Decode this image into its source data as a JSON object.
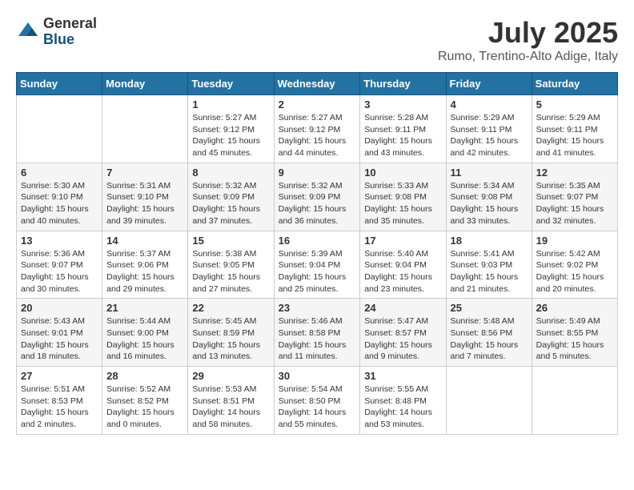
{
  "header": {
    "logo_general": "General",
    "logo_blue": "Blue",
    "month_title": "July 2025",
    "subtitle": "Rumo, Trentino-Alto Adige, Italy"
  },
  "days_of_week": [
    "Sunday",
    "Monday",
    "Tuesday",
    "Wednesday",
    "Thursday",
    "Friday",
    "Saturday"
  ],
  "weeks": [
    [
      {
        "day": "",
        "info": ""
      },
      {
        "day": "",
        "info": ""
      },
      {
        "day": "1",
        "info": "Sunrise: 5:27 AM\nSunset: 9:12 PM\nDaylight: 15 hours\nand 45 minutes."
      },
      {
        "day": "2",
        "info": "Sunrise: 5:27 AM\nSunset: 9:12 PM\nDaylight: 15 hours\nand 44 minutes."
      },
      {
        "day": "3",
        "info": "Sunrise: 5:28 AM\nSunset: 9:11 PM\nDaylight: 15 hours\nand 43 minutes."
      },
      {
        "day": "4",
        "info": "Sunrise: 5:29 AM\nSunset: 9:11 PM\nDaylight: 15 hours\nand 42 minutes."
      },
      {
        "day": "5",
        "info": "Sunrise: 5:29 AM\nSunset: 9:11 PM\nDaylight: 15 hours\nand 41 minutes."
      }
    ],
    [
      {
        "day": "6",
        "info": "Sunrise: 5:30 AM\nSunset: 9:10 PM\nDaylight: 15 hours\nand 40 minutes."
      },
      {
        "day": "7",
        "info": "Sunrise: 5:31 AM\nSunset: 9:10 PM\nDaylight: 15 hours\nand 39 minutes."
      },
      {
        "day": "8",
        "info": "Sunrise: 5:32 AM\nSunset: 9:09 PM\nDaylight: 15 hours\nand 37 minutes."
      },
      {
        "day": "9",
        "info": "Sunrise: 5:32 AM\nSunset: 9:09 PM\nDaylight: 15 hours\nand 36 minutes."
      },
      {
        "day": "10",
        "info": "Sunrise: 5:33 AM\nSunset: 9:08 PM\nDaylight: 15 hours\nand 35 minutes."
      },
      {
        "day": "11",
        "info": "Sunrise: 5:34 AM\nSunset: 9:08 PM\nDaylight: 15 hours\nand 33 minutes."
      },
      {
        "day": "12",
        "info": "Sunrise: 5:35 AM\nSunset: 9:07 PM\nDaylight: 15 hours\nand 32 minutes."
      }
    ],
    [
      {
        "day": "13",
        "info": "Sunrise: 5:36 AM\nSunset: 9:07 PM\nDaylight: 15 hours\nand 30 minutes."
      },
      {
        "day": "14",
        "info": "Sunrise: 5:37 AM\nSunset: 9:06 PM\nDaylight: 15 hours\nand 29 minutes."
      },
      {
        "day": "15",
        "info": "Sunrise: 5:38 AM\nSunset: 9:05 PM\nDaylight: 15 hours\nand 27 minutes."
      },
      {
        "day": "16",
        "info": "Sunrise: 5:39 AM\nSunset: 9:04 PM\nDaylight: 15 hours\nand 25 minutes."
      },
      {
        "day": "17",
        "info": "Sunrise: 5:40 AM\nSunset: 9:04 PM\nDaylight: 15 hours\nand 23 minutes."
      },
      {
        "day": "18",
        "info": "Sunrise: 5:41 AM\nSunset: 9:03 PM\nDaylight: 15 hours\nand 21 minutes."
      },
      {
        "day": "19",
        "info": "Sunrise: 5:42 AM\nSunset: 9:02 PM\nDaylight: 15 hours\nand 20 minutes."
      }
    ],
    [
      {
        "day": "20",
        "info": "Sunrise: 5:43 AM\nSunset: 9:01 PM\nDaylight: 15 hours\nand 18 minutes."
      },
      {
        "day": "21",
        "info": "Sunrise: 5:44 AM\nSunset: 9:00 PM\nDaylight: 15 hours\nand 16 minutes."
      },
      {
        "day": "22",
        "info": "Sunrise: 5:45 AM\nSunset: 8:59 PM\nDaylight: 15 hours\nand 13 minutes."
      },
      {
        "day": "23",
        "info": "Sunrise: 5:46 AM\nSunset: 8:58 PM\nDaylight: 15 hours\nand 11 minutes."
      },
      {
        "day": "24",
        "info": "Sunrise: 5:47 AM\nSunset: 8:57 PM\nDaylight: 15 hours\nand 9 minutes."
      },
      {
        "day": "25",
        "info": "Sunrise: 5:48 AM\nSunset: 8:56 PM\nDaylight: 15 hours\nand 7 minutes."
      },
      {
        "day": "26",
        "info": "Sunrise: 5:49 AM\nSunset: 8:55 PM\nDaylight: 15 hours\nand 5 minutes."
      }
    ],
    [
      {
        "day": "27",
        "info": "Sunrise: 5:51 AM\nSunset: 8:53 PM\nDaylight: 15 hours\nand 2 minutes."
      },
      {
        "day": "28",
        "info": "Sunrise: 5:52 AM\nSunset: 8:52 PM\nDaylight: 15 hours\nand 0 minutes."
      },
      {
        "day": "29",
        "info": "Sunrise: 5:53 AM\nSunset: 8:51 PM\nDaylight: 14 hours\nand 58 minutes."
      },
      {
        "day": "30",
        "info": "Sunrise: 5:54 AM\nSunset: 8:50 PM\nDaylight: 14 hours\nand 55 minutes."
      },
      {
        "day": "31",
        "info": "Sunrise: 5:55 AM\nSunset: 8:48 PM\nDaylight: 14 hours\nand 53 minutes."
      },
      {
        "day": "",
        "info": ""
      },
      {
        "day": "",
        "info": ""
      }
    ]
  ]
}
